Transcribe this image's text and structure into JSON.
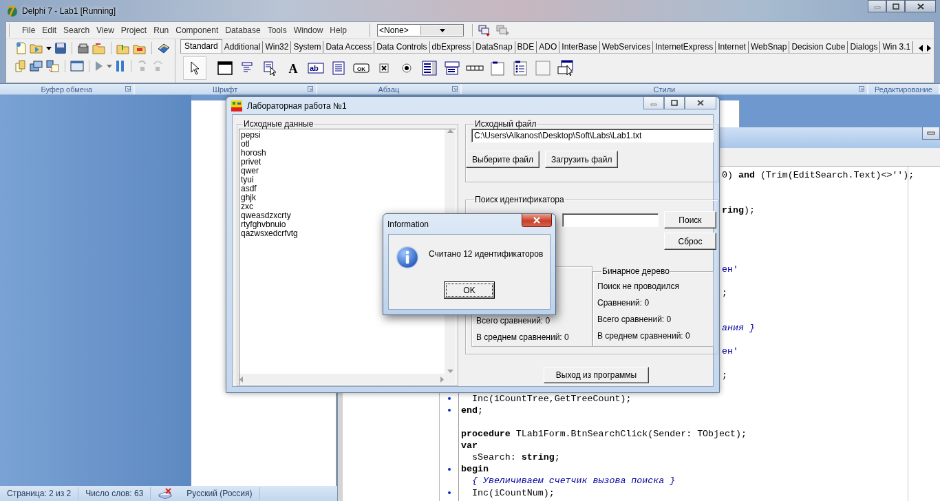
{
  "delphi": {
    "title": "Delphi 7 - Lab1 [Running]",
    "menu": [
      "File",
      "Edit",
      "Search",
      "View",
      "Project",
      "Run",
      "Component",
      "Database",
      "Tools",
      "Window",
      "Help"
    ],
    "target_combo": "<None>",
    "palette_tabs": [
      {
        "label": "Standard",
        "selected": true
      },
      {
        "label": "Additional",
        "selected": false
      },
      {
        "label": "Win32",
        "selected": false
      },
      {
        "label": "System",
        "selected": false
      },
      {
        "label": "Data Access",
        "selected": false
      },
      {
        "label": "Data Controls",
        "selected": false
      },
      {
        "label": "dbExpress",
        "selected": false
      },
      {
        "label": "DataSnap",
        "selected": false
      },
      {
        "label": "BDE",
        "selected": false
      },
      {
        "label": "ADO",
        "selected": false
      },
      {
        "label": "InterBase",
        "selected": false
      },
      {
        "label": "WebServices",
        "selected": false
      },
      {
        "label": "InternetExpress",
        "selected": false
      },
      {
        "label": "Internet",
        "selected": false
      },
      {
        "label": "WebSnap",
        "selected": false
      },
      {
        "label": "Decision Cube",
        "selected": false
      },
      {
        "label": "Dialogs",
        "selected": false
      },
      {
        "label": "Win 3.1",
        "selected": false
      }
    ],
    "palette_components": [
      {
        "kind": "pointer",
        "selected": true
      },
      {
        "kind": "frame",
        "selected": false
      },
      {
        "kind": "menu",
        "selected": false
      },
      {
        "kind": "popup",
        "selected": false
      },
      {
        "kind": "label",
        "glyph": "A",
        "selected": false
      },
      {
        "kind": "edit",
        "glyph": "ab",
        "selected": false
      },
      {
        "kind": "memo",
        "selected": false
      },
      {
        "kind": "button",
        "glyph": "OK",
        "selected": false
      },
      {
        "kind": "checkbox",
        "selected": false
      },
      {
        "kind": "radio",
        "selected": false
      },
      {
        "kind": "listbox",
        "selected": false
      },
      {
        "kind": "combobox",
        "selected": false
      },
      {
        "kind": "scrollbar",
        "selected": false
      },
      {
        "kind": "groupbox",
        "selected": false
      },
      {
        "kind": "radiogroup",
        "selected": false
      },
      {
        "kind": "panel",
        "selected": false
      },
      {
        "kind": "actionlist",
        "selected": false
      }
    ]
  },
  "word": {
    "ribbon_groups": [
      "Буфер обмена",
      "Шрифт",
      "Абзац",
      "Стили",
      "Редактирование"
    ],
    "status_bar": {
      "page": "Страница: 2 из 2",
      "words": "Число слов: 63",
      "language": "Русский (Россия)"
    }
  },
  "editor": {
    "lines": [
      {
        "kind": "tail",
        "text": "0) **and** (Trim(EditSearch.Text)<>'');"
      },
      {
        "kind": "blank"
      },
      {
        "kind": "blank"
      },
      {
        "kind": "tail",
        "text": "**ring**);"
      },
      {
        "kind": "blank"
      },
      {
        "kind": "blank"
      },
      {
        "kind": "blank"
      },
      {
        "kind": "blank"
      },
      {
        "kind": "tail-string",
        "text": "ен'"
      },
      {
        "kind": "blank"
      },
      {
        "kind": "tail",
        "text": ";"
      },
      {
        "kind": "blank"
      },
      {
        "kind": "blank"
      },
      {
        "kind": "tail-comment",
        "text": "ания }"
      },
      {
        "kind": "blank"
      },
      {
        "kind": "tail-string",
        "text": "ен'"
      },
      {
        "kind": "blank"
      },
      {
        "kind": "tail",
        "text": ";"
      },
      {
        "kind": "blank"
      },
      {
        "kind": "code",
        "text": "  Inc(iCountTree,GetTreeCount);",
        "executable": true
      },
      {
        "kind": "code",
        "text": "**end**;",
        "executable": true
      },
      {
        "kind": "blank",
        "executable": false
      },
      {
        "kind": "code",
        "text": "**procedure** TLab1Form.BtnSearchClick(Sender: TObject);",
        "executable": false
      },
      {
        "kind": "code",
        "text": "**var**",
        "executable": false
      },
      {
        "kind": "code",
        "text": "  sSearch: **string**;",
        "executable": false
      },
      {
        "kind": "code",
        "text": "**begin**",
        "executable": true
      },
      {
        "kind": "comment",
        "text": "  { Увеличиваем счетчик вызова поиска }",
        "executable": false
      },
      {
        "kind": "code",
        "text": "  Inc(iCountNum);",
        "executable": true
      }
    ]
  },
  "form": {
    "title": "Лабораторная работа №1",
    "source_group": {
      "title": "Исходные данные",
      "items": [
        "pepsi",
        "otl",
        "horosh",
        "privet",
        "qwer",
        "tyui",
        "asdf",
        "ghjk",
        "zxc",
        "qweasdzxcrty",
        "rtyfghvbnuio",
        "qazwsxedcrfvtg"
      ]
    },
    "file_group": {
      "title": "Исходный файл",
      "path": "C:\\Users\\Alkanost\\Desktop\\Soft\\Labs\\Lab1.txt",
      "buttons": [
        "Выберите файл",
        "Загрузить файл"
      ]
    },
    "search_group": {
      "title": "Поиск идентификатора",
      "buttons": [
        "Поиск",
        "Сброс"
      ],
      "hash_stats": [
        "Всего сравнений: 0",
        "В среднем сравнений: 0"
      ],
      "tree_group": {
        "title": "Бинарное дерево",
        "lines": [
          "Поиск не проводился",
          "Сравнений: 0",
          "Всего сравнений: 0",
          "В среднем сравнений: 0"
        ]
      }
    },
    "exit_button": "Выход из программы"
  },
  "dialog": {
    "title": "Information",
    "message": "Считано 12 идентификаторов",
    "button": "OK"
  }
}
